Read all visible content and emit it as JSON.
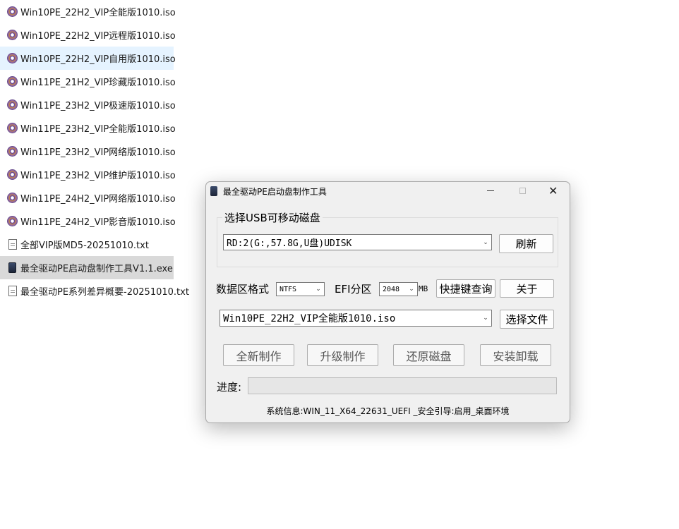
{
  "files": [
    {
      "name": "Win10PE_22H2_VIP全能版1010.iso",
      "icon": "disc-icon",
      "state": "normal"
    },
    {
      "name": "Win10PE_22H2_VIP远程版1010.iso",
      "icon": "disc-icon",
      "state": "normal"
    },
    {
      "name": "Win10PE_22H2_VIP自用版1010.iso",
      "icon": "disc-icon",
      "state": "hover"
    },
    {
      "name": "Win11PE_21H2_VIP珍藏版1010.iso",
      "icon": "disc-icon",
      "state": "normal"
    },
    {
      "name": "Win11PE_23H2_VIP极速版1010.iso",
      "icon": "disc-icon",
      "state": "normal"
    },
    {
      "name": "Win11PE_23H2_VIP全能版1010.iso",
      "icon": "disc-icon",
      "state": "normal"
    },
    {
      "name": "Win11PE_23H2_VIP网络版1010.iso",
      "icon": "disc-icon",
      "state": "normal"
    },
    {
      "name": "Win11PE_23H2_VIP维护版1010.iso",
      "icon": "disc-icon",
      "state": "normal"
    },
    {
      "name": "Win11PE_24H2_VIP网络版1010.iso",
      "icon": "disc-icon",
      "state": "normal"
    },
    {
      "name": "Win11PE_24H2_VIP影音版1010.iso",
      "icon": "disc-icon",
      "state": "normal"
    },
    {
      "name": "全部VIP版MD5-20251010.txt",
      "icon": "text-file-icon",
      "state": "normal"
    },
    {
      "name": "最全驱动PE启动盘制作工具V1.1.exe",
      "icon": "exe-icon",
      "state": "selected"
    },
    {
      "name": "最全驱动PE系列差异概要-20251010.txt",
      "icon": "text-file-icon",
      "state": "normal"
    }
  ],
  "dialog": {
    "title": "最全驱动PE启动盘制作工具",
    "usb_group_label": "选择USB可移动磁盘",
    "usb_disk_value": "RD:2(G:,57.8G,U盘)UDISK",
    "refresh_label": "刷新",
    "data_format_label": "数据区格式",
    "data_format_value": "NTFS",
    "efi_label": "EFI分区",
    "efi_value": "2048",
    "efi_unit": "MB",
    "hotkey_label": "快捷键查询",
    "about_label": "关于",
    "iso_value": "Win10PE_22H2_VIP全能版1010.iso",
    "choose_file_label": "选择文件",
    "actions": [
      "全新制作",
      "升级制作",
      "还原磁盘",
      "安装卸载"
    ],
    "progress_label": "进度:",
    "progress_value": 0,
    "sysinfo": "系统信息:WIN_11_X64_22631_UEFI _安全引导:启用_桌面环境"
  },
  "colors": {
    "hover_row": "#e5f3ff",
    "selected_row": "#d9d9d9",
    "dialog_bg": "#f0f0f0"
  }
}
